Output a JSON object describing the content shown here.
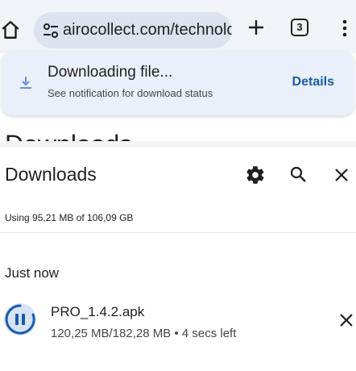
{
  "browser": {
    "url": "airocollect.com/technolc",
    "tab_count": "3",
    "icons": [
      "home-icon",
      "tune-icon",
      "plus-icon",
      "tab-switcher-icon",
      "more-vert-icon"
    ]
  },
  "bubble": {
    "title": "Downloading file...",
    "subtitle": "See notification for download status",
    "action": "Details",
    "accent": "#1b5ba8"
  },
  "downloads": {
    "peek_title": "Downloads",
    "title": "Downloads",
    "storage": "Using 95,21 MB of 106,09 GB",
    "section": "Just now",
    "items": [
      {
        "name": "PRO_1.4.2.apk",
        "meta": "120,25 MB/182,28 MB • 4 secs left"
      }
    ]
  }
}
